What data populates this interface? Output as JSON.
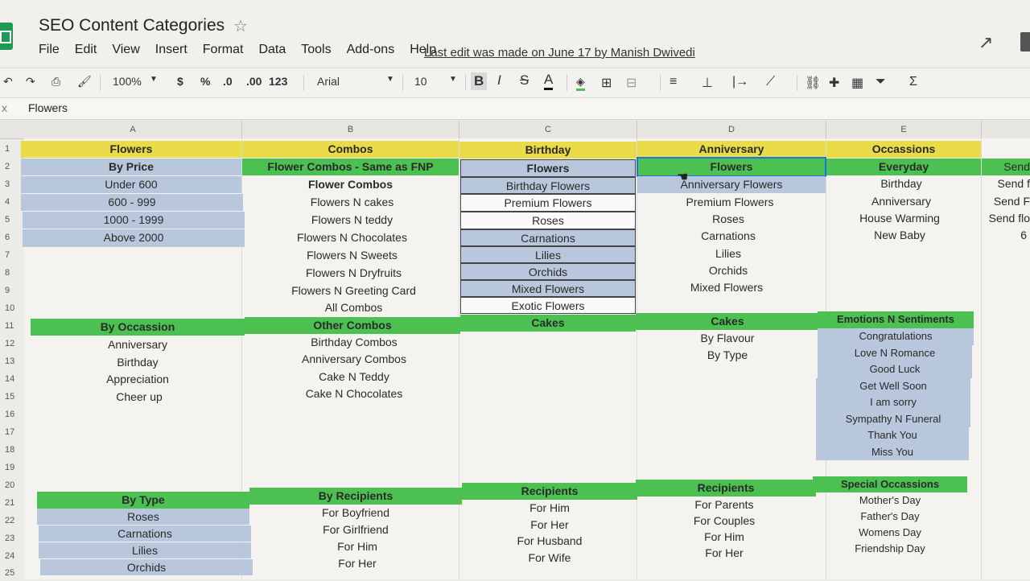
{
  "doc_title": "SEO Content Categories",
  "menu": [
    "File",
    "Edit",
    "View",
    "Insert",
    "Format",
    "Data",
    "Tools",
    "Add-ons",
    "Help"
  ],
  "last_edit": "Last edit was made on June 17 by Manish Dwivedi",
  "toolbar": {
    "zoom": "100%",
    "currency": "$",
    "percent": "%",
    "dec_less": ".0",
    "dec_more": ".00",
    "format": "123",
    "font": "Arial",
    "size": "10",
    "bold": "B",
    "italic": "I",
    "strike": "S",
    "color": "A"
  },
  "formula": {
    "value": "Flowers"
  },
  "columns": [
    "A",
    "B",
    "C",
    "D",
    "E"
  ],
  "rows": [
    "1",
    "2",
    "3",
    "4",
    "5",
    "6",
    "7",
    "8",
    "9",
    "10",
    "11",
    "12",
    "13",
    "14",
    "15",
    "16",
    "17",
    "18",
    "19",
    "20",
    "21",
    "22",
    "23",
    "24",
    "25"
  ],
  "colA": {
    "r1": "Flowers",
    "r2": "By Price",
    "r3": "Under 600",
    "r4": "600 - 999",
    "r5": "1000 - 1999",
    "r6": "Above 2000",
    "r11": "By Occassion",
    "r12": "Anniversary",
    "r13": "Birthday",
    "r14": "Appreciation",
    "r15": "Cheer up",
    "r21": "By Type",
    "r22": "Roses",
    "r23": "Carnations",
    "r24": "Lilies",
    "r25": "Orchids"
  },
  "colB": {
    "r1": "Combos",
    "r2": "Flower Combos - Same as FNP",
    "r3": "Flower Combos",
    "r4": "Flowers N cakes",
    "r5": "Flowers N teddy",
    "r6": "Flowers N Chocolates",
    "r7": "Flowers N Sweets",
    "r8": "Flowers N Dryfruits",
    "r9": "Flowers N Greeting Card",
    "r10": "All Combos",
    "r11": "Other Combos",
    "r12": "Birthday Combos",
    "r13": "Anniversary Combos",
    "r14": "Cake N Teddy",
    "r15": "Cake N Chocolates",
    "r21": "By Recipients",
    "r22": "For Boyfriend",
    "r23": "For Girlfriend",
    "r24": "For Him",
    "r25": "For Her"
  },
  "colC": {
    "r1": "Birthday",
    "r2": "Flowers",
    "r3": "Birthday Flowers",
    "r4": "Premium Flowers",
    "r5": "Roses",
    "r6": "Carnations",
    "r7": "Lilies",
    "r8": "Orchids",
    "r9": "Mixed Flowers",
    "r10": "Exotic Flowers",
    "r11": "Cakes",
    "r21": "Recipients",
    "r22": "For Him",
    "r23": "For Her",
    "r24": "For Husband",
    "r25": "For Wife"
  },
  "colD": {
    "r1": "Anniversary",
    "r2": "Flowers",
    "r3": "Anniversary Flowers",
    "r4": "Premium Flowers",
    "r5": "Roses",
    "r6": "Carnations",
    "r7": "Lilies",
    "r8": "Orchids",
    "r9": "Mixed Flowers",
    "r11": "Cakes",
    "r12": "By Flavour",
    "r13": "By Type",
    "r21": "Recipients",
    "r22": "For Parents",
    "r23": "For Couples",
    "r24": "For Him",
    "r25": "For Her"
  },
  "colE": {
    "r1": "Occassions",
    "r2": "Everyday",
    "r3": "Birthday",
    "r4": "Anniversary",
    "r5": "House Warming",
    "r6": "New Baby",
    "r11": "Emotions N Sentiments",
    "r12": "Congratulations",
    "r13": "Love N Romance",
    "r14": "Good Luck",
    "r15": "Get Well Soon",
    "r16": "I am sorry",
    "r17": "Sympathy N Funeral",
    "r18": "Thank You",
    "r19": "Miss You",
    "r21": "Special Occassions",
    "r22": "Mother's Day",
    "r23": "Father's Day",
    "r24": "Womens Day",
    "r25": "Friendship Day"
  },
  "colF": {
    "r2": "Send",
    "r3": "Send f",
    "r4": "Send F",
    "r5": "Send flo",
    "r6": "6"
  }
}
